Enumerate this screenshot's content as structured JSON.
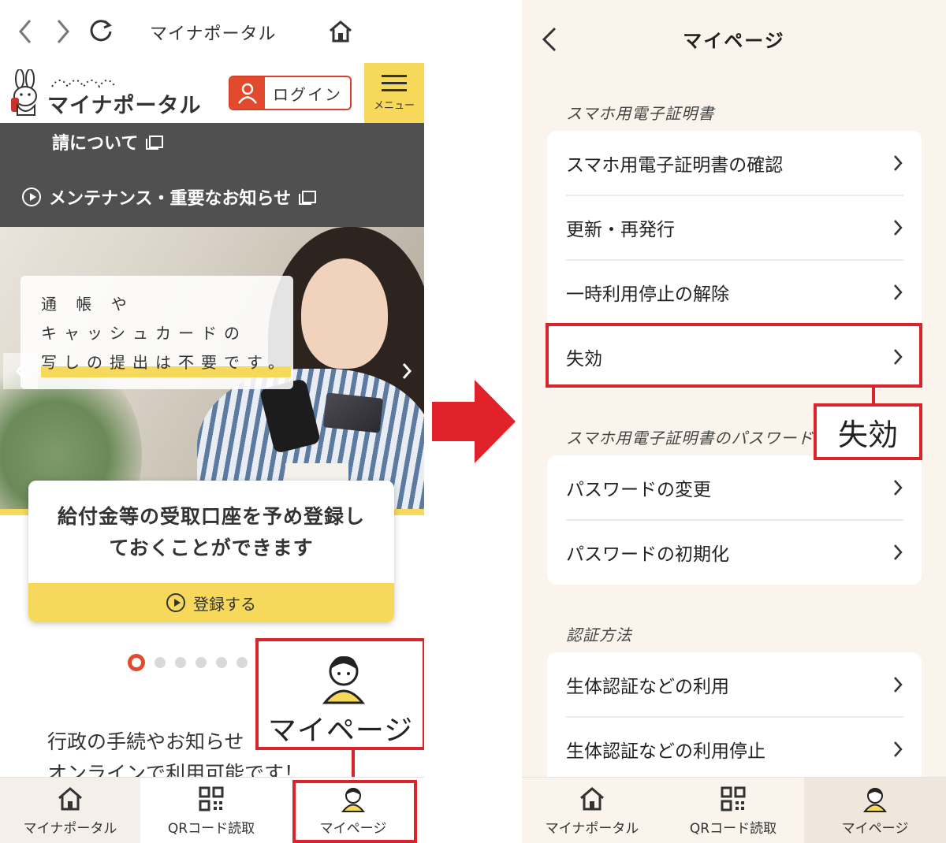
{
  "left": {
    "browser": {
      "title": "マイナポータル"
    },
    "header": {
      "logo_text": "マイナポータル",
      "login_label": "ログイン",
      "menu_label": "メニュー"
    },
    "band": {
      "line1": "請について",
      "line2": "メンテナンス・重要なお知らせ"
    },
    "hero": {
      "bubble_line1": "通 帳 や",
      "bubble_line2": "キャッシュカードの",
      "bubble_line3": "写しの提出は不要です。"
    },
    "card": {
      "title_line1": "給付金等の受取口座を予め登録し",
      "title_line2": "ておくことができます",
      "action_label": "登録する"
    },
    "carousel": {
      "active_index": 0,
      "count": 6
    },
    "intro": {
      "line1": "行政の手続やお知らせ",
      "line2": "オンラインで利用可能です！"
    },
    "callout_label": "マイページ",
    "nav": [
      {
        "label": "マイナポータル",
        "icon": "house-icon"
      },
      {
        "label": "QRコード読取",
        "icon": "qr-code-icon"
      },
      {
        "label": "マイページ",
        "icon": "person-icon"
      }
    ]
  },
  "right": {
    "title": "マイページ",
    "sections": [
      {
        "label": "スマホ用電子証明書",
        "items": [
          "スマホ用電子証明書の確認",
          "更新・再発行",
          "一時利用停止の解除",
          "失効"
        ]
      },
      {
        "label": "スマホ用電子証明書のパスワード",
        "items": [
          "パスワードの変更",
          "パスワードの初期化"
        ]
      },
      {
        "label": "認証方法",
        "items": [
          "生体認証などの利用",
          "生体認証などの利用停止"
        ]
      }
    ],
    "callout_label": "失効",
    "nav": [
      {
        "label": "マイナポータル",
        "icon": "house-icon"
      },
      {
        "label": "QRコード読取",
        "icon": "qr-code-icon"
      },
      {
        "label": "マイページ",
        "icon": "person-icon"
      }
    ]
  },
  "colors": {
    "accent_yellow": "#f6d85a",
    "brand_red": "#e24a2e",
    "annotation_red": "#d9242b",
    "right_background": "#faf4ec"
  }
}
